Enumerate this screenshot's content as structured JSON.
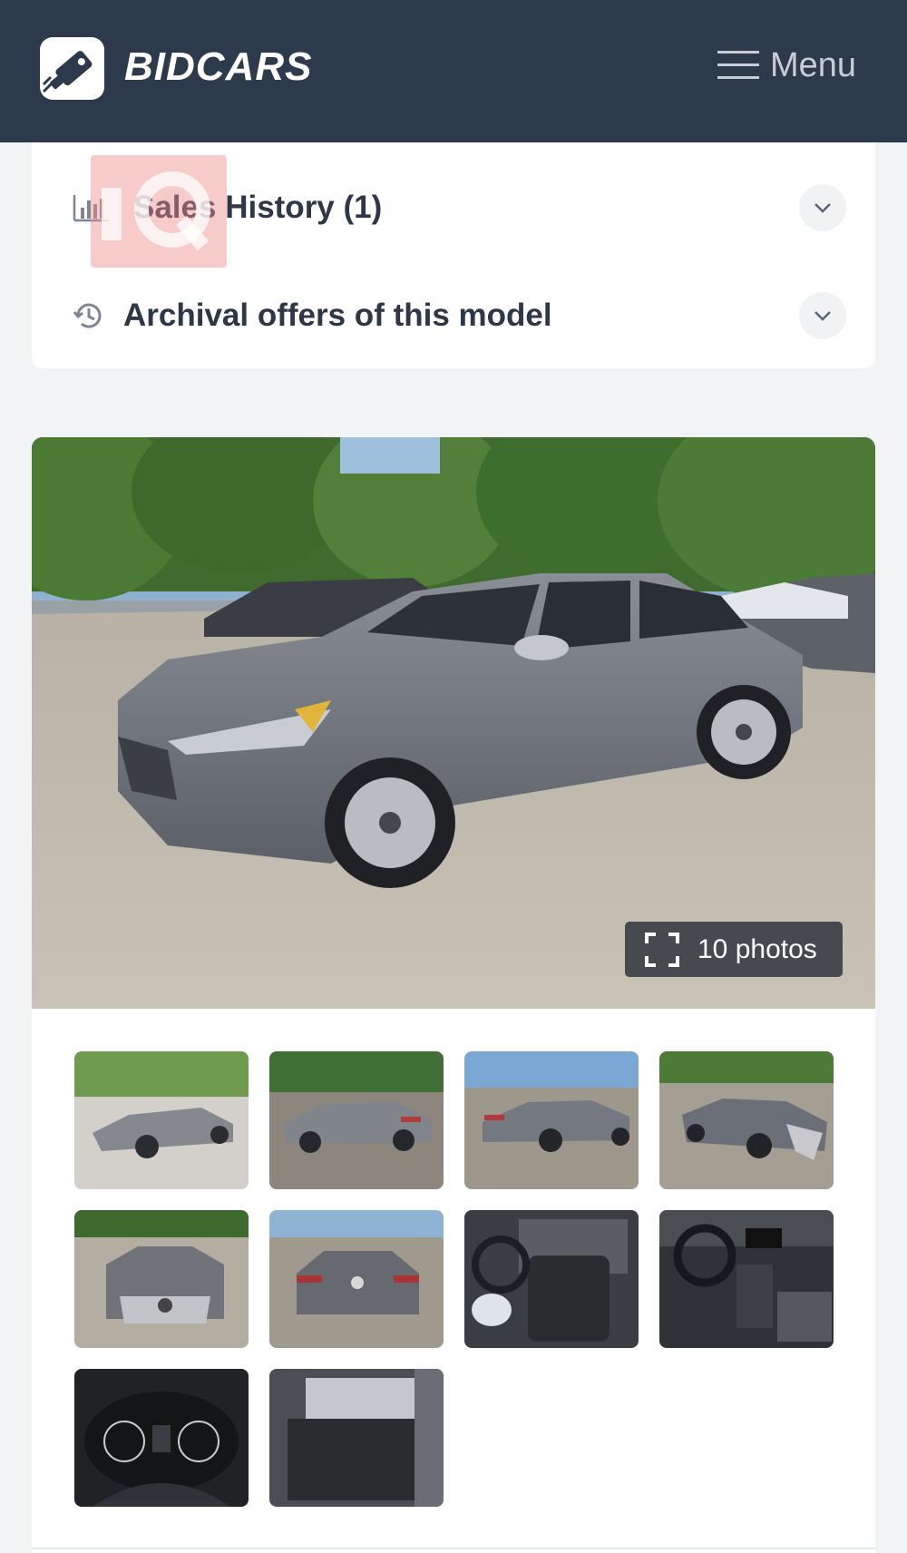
{
  "header": {
    "brand": "BIDCARS",
    "menu_label": "Menu",
    "logo_icon": "key-tag-icon",
    "menu_icon": "hamburger-icon",
    "background": "#2d3a4b"
  },
  "accordion": {
    "items": [
      {
        "label": "Sales History (1)",
        "icon": "bar-chart-icon",
        "chevron": "chevron-down-icon"
      },
      {
        "label": "Archival offers of this model",
        "icon": "history-icon",
        "chevron": "chevron-down-icon"
      }
    ],
    "watermark": "IQ"
  },
  "gallery": {
    "photos_label": "10 photos",
    "expand_icon": "fullscreen-icon",
    "main_photo": "damaged gray sedan front-left view in parking lot",
    "thumbnails": [
      "front-left view",
      "rear-left view",
      "rear view",
      "front-right damaged view",
      "front damaged view",
      "rear view centered",
      "interior driver seat",
      "dashboard interior",
      "instrument cluster",
      "rear seats"
    ]
  },
  "colors": {
    "accent_dark": "#2d3a4b",
    "page_bg": "#f1f3f5",
    "car_gray": "#6d7179"
  }
}
